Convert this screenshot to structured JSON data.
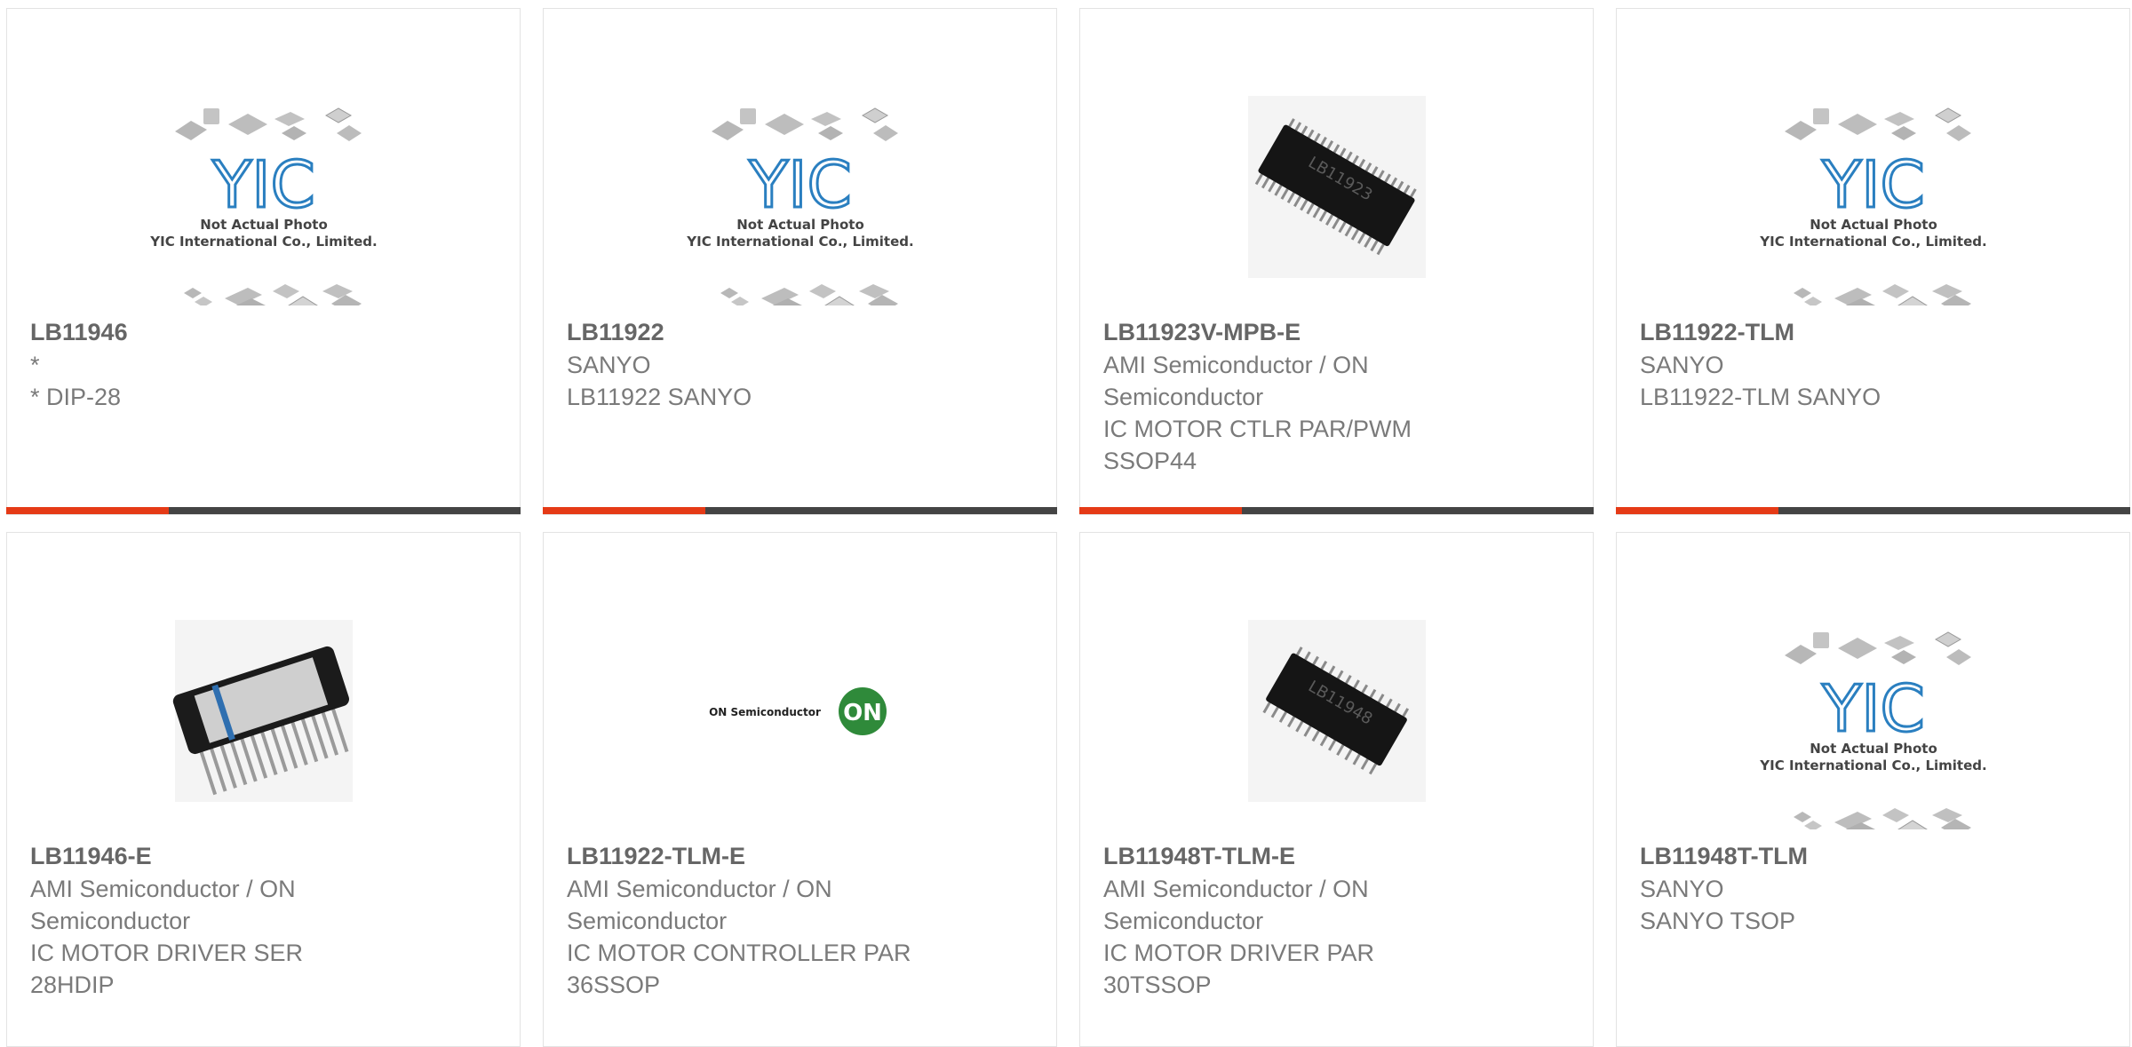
{
  "placeholder_image": {
    "line1": "Not Actual Photo",
    "line2": "YIC International Co., Limited.",
    "logo": "YIC"
  },
  "on_logo": {
    "brand_text": "ON Semiconductor",
    "badge": "ON"
  },
  "accent_color": "#e53a16",
  "bar_color": "#444444",
  "products": [
    {
      "part": "LB11946",
      "lines": [
        "*",
        "* DIP-28"
      ],
      "image": "placeholder"
    },
    {
      "part": "LB11922",
      "lines": [
        "SANYO",
        "LB11922 SANYO"
      ],
      "image": "placeholder"
    },
    {
      "part": "LB11923V-MPB-E",
      "lines": [
        "AMI Semiconductor / ON",
        "Semiconductor",
        "IC MOTOR CTLR PAR/PWM",
        "SSOP44"
      ],
      "image": "chip-ssop",
      "chip_label": "LB11923"
    },
    {
      "part": "LB11922-TLM",
      "lines": [
        "SANYO",
        "LB11922-TLM SANYO"
      ],
      "image": "placeholder"
    },
    {
      "part": "LB11946-E",
      "lines": [
        "AMI Semiconductor / ON",
        "Semiconductor",
        "IC MOTOR DRIVER SER",
        "28HDIP"
      ],
      "image": "chip-hdip"
    },
    {
      "part": "LB11922-TLM-E",
      "lines": [
        "AMI Semiconductor / ON",
        "Semiconductor",
        "IC MOTOR CONTROLLER PAR",
        "36SSOP"
      ],
      "image": "on-logo"
    },
    {
      "part": "LB11948T-TLM-E",
      "lines": [
        "AMI Semiconductor / ON",
        "Semiconductor",
        "IC MOTOR DRIVER PAR",
        "30TSSOP"
      ],
      "image": "chip-tssop",
      "chip_label": "LB11948"
    },
    {
      "part": "LB11948T-TLM",
      "lines": [
        "SANYO",
        "SANYO TSOP"
      ],
      "image": "placeholder"
    }
  ]
}
